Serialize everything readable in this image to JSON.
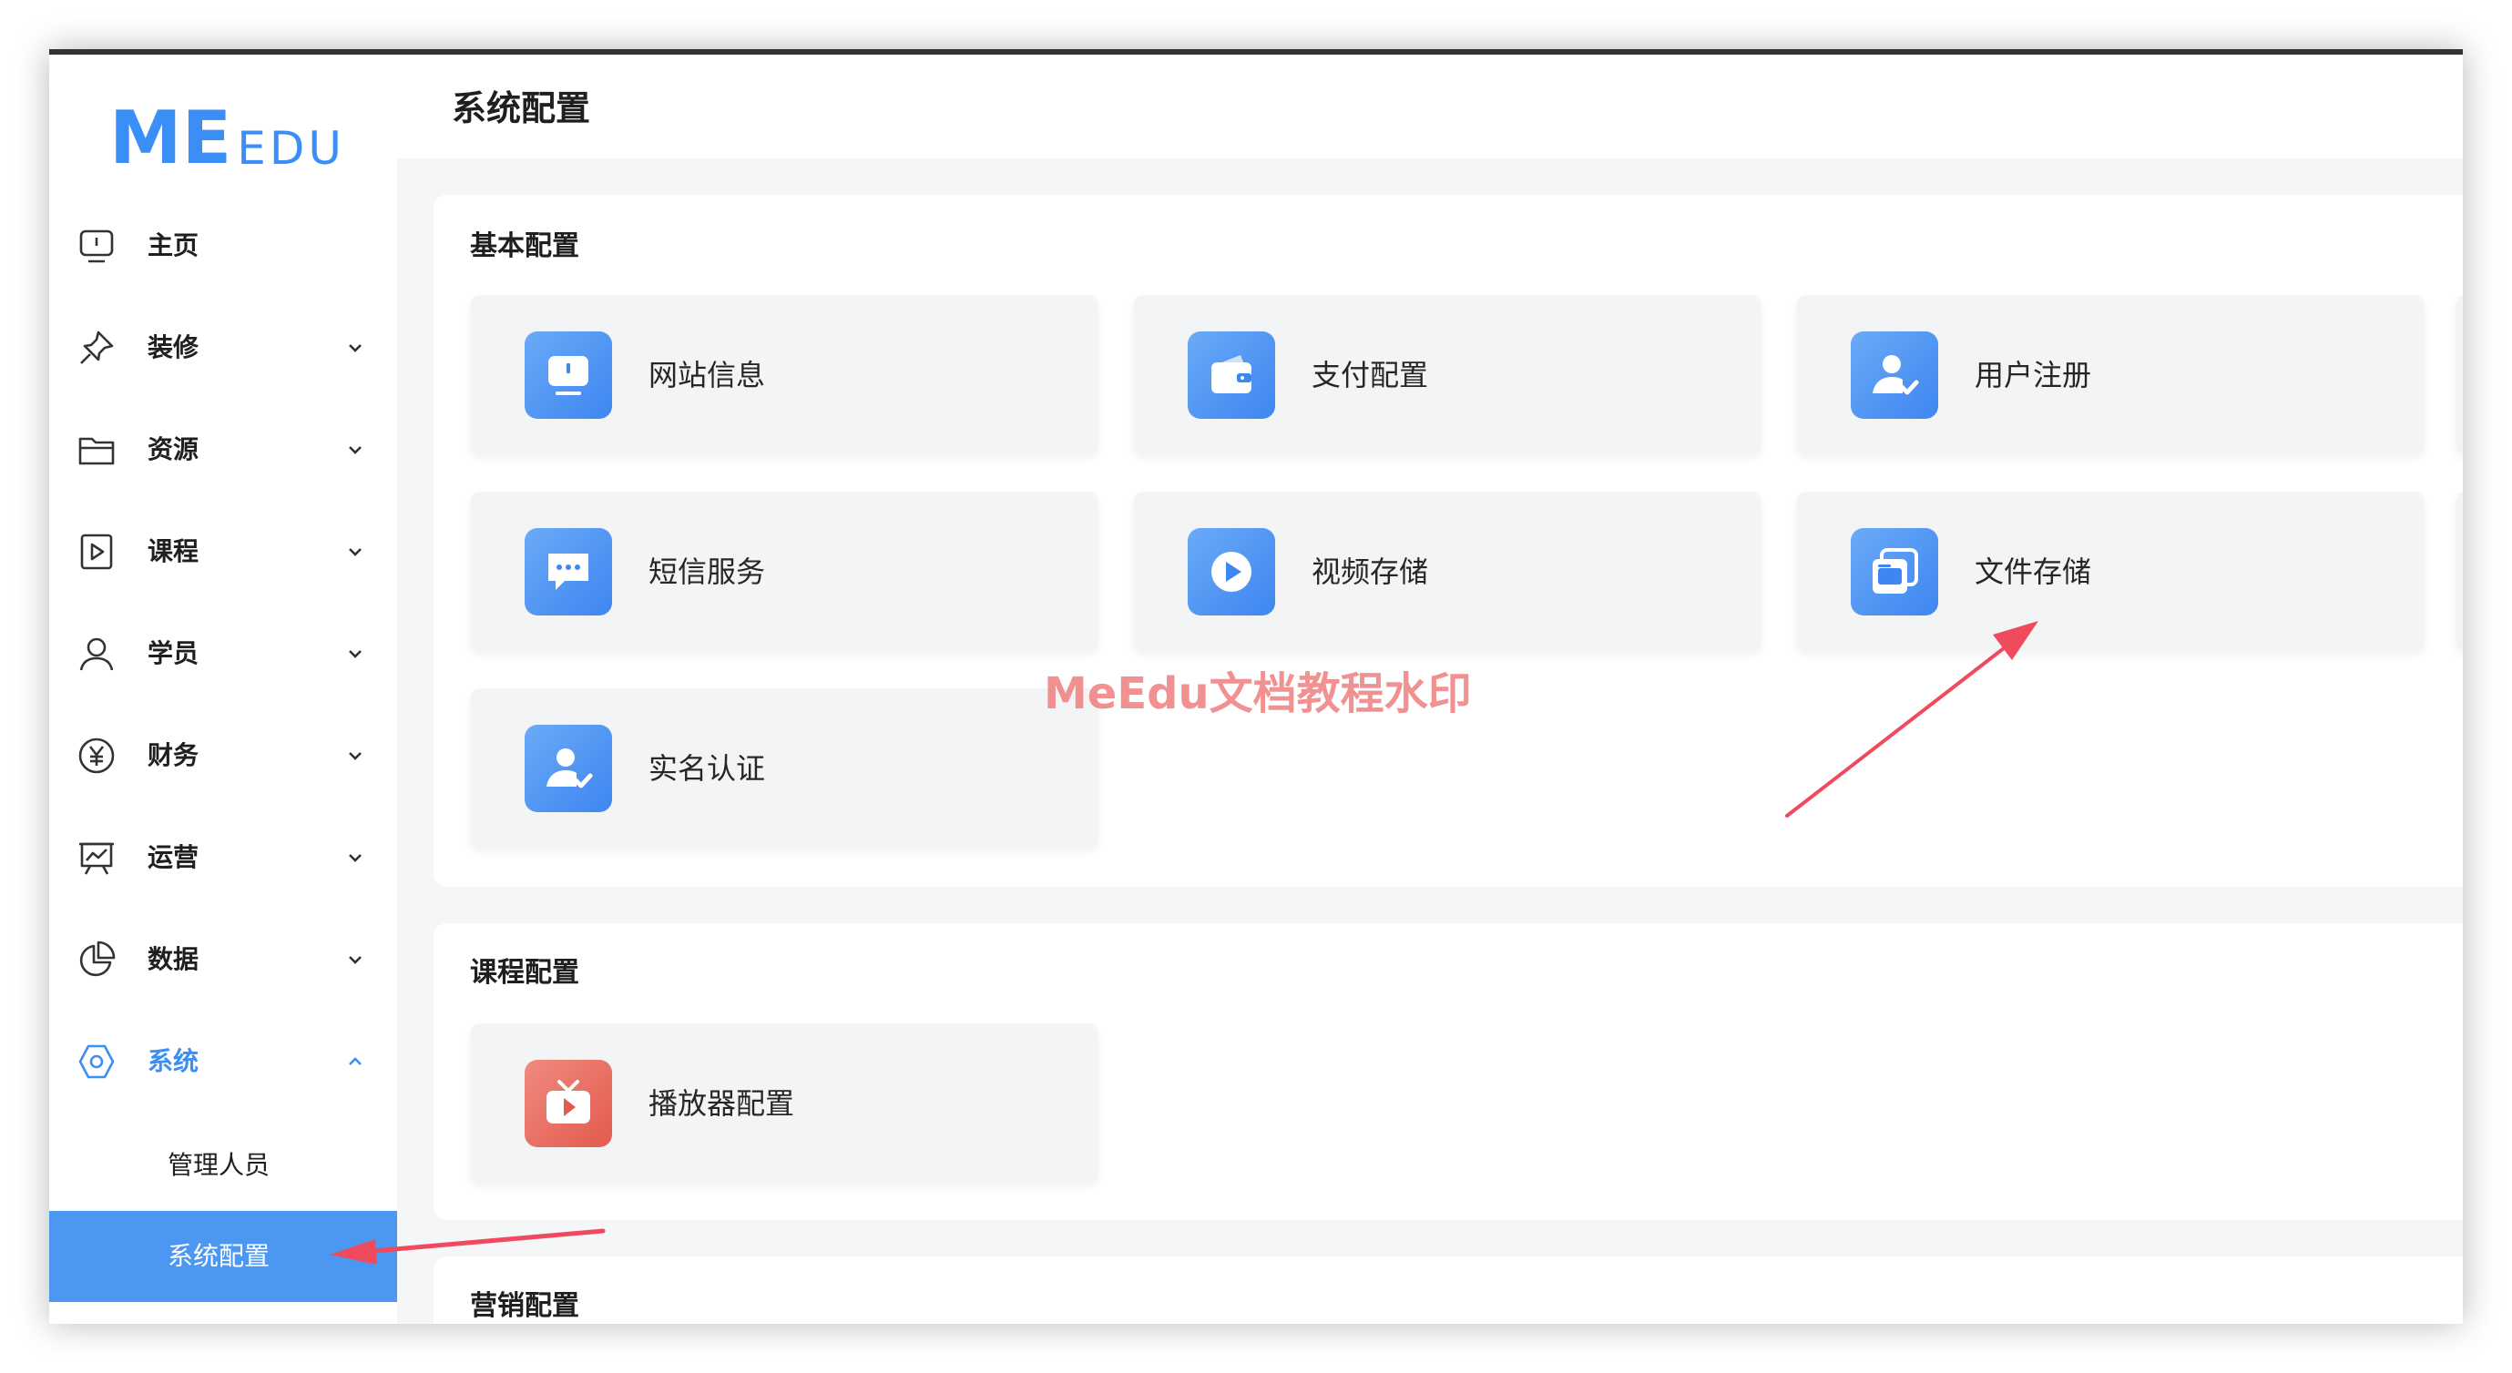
{
  "app": {
    "logo_m": "M",
    "logo_e": "E",
    "logo_rest": "EDU",
    "accent_color": "#3a8ef5"
  },
  "sidebar": {
    "items": [
      {
        "label": "主页",
        "icon": "monitor-icon",
        "expandable": false
      },
      {
        "label": "装修",
        "icon": "pushpin-icon",
        "expandable": true
      },
      {
        "label": "资源",
        "icon": "folder-icon",
        "expandable": true
      },
      {
        "label": "课程",
        "icon": "play-square-icon",
        "expandable": true
      },
      {
        "label": "学员",
        "icon": "user-icon",
        "expandable": true
      },
      {
        "label": "财务",
        "icon": "yen-circle-icon",
        "expandable": true
      },
      {
        "label": "运营",
        "icon": "chart-board-icon",
        "expandable": true
      },
      {
        "label": "数据",
        "icon": "pie-chart-icon",
        "expandable": true
      },
      {
        "label": "系统",
        "icon": "settings-hex-icon",
        "expandable": true,
        "expanded": true,
        "active": true
      }
    ],
    "sub_items": [
      {
        "label": "管理人员",
        "selected": false
      },
      {
        "label": "系统配置",
        "selected": true
      }
    ]
  },
  "header": {
    "title": "系统配置"
  },
  "sections": [
    {
      "title": "基本配置",
      "cards": [
        {
          "label": "网站信息",
          "icon": "monitor-icon"
        },
        {
          "label": "支付配置",
          "icon": "wallet-icon"
        },
        {
          "label": "用户注册",
          "icon": "user-check-icon"
        },
        {
          "label": "短信服务",
          "icon": "message-icon"
        },
        {
          "label": "视频存储",
          "icon": "play-circle-icon"
        },
        {
          "label": "文件存储",
          "icon": "gallery-icon"
        },
        {
          "label": "实名认证",
          "icon": "user-verify-icon"
        }
      ]
    },
    {
      "title": "课程配置",
      "cards": [
        {
          "label": "播放器配置",
          "icon": "tv-play-icon"
        }
      ]
    },
    {
      "title": "营销配置",
      "cards": []
    }
  ],
  "watermark": "MeEdu文档教程水印"
}
